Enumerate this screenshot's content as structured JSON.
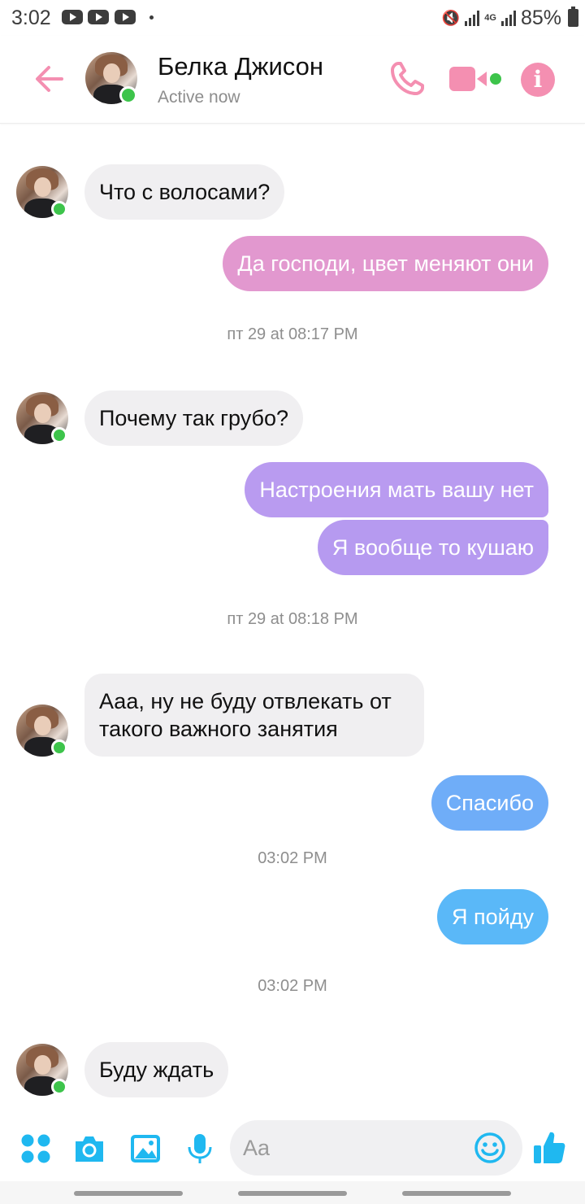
{
  "status_bar": {
    "time": "3:02",
    "network": "4G",
    "battery": "85%",
    "icons": [
      "youtube-icon",
      "youtube-icon",
      "youtube-icon",
      "mute-icon",
      "signal-icon",
      "battery-icon"
    ]
  },
  "header": {
    "name": "Белка Джисон",
    "status": "Active now",
    "icons": {
      "back": "back-arrow-icon",
      "call": "phone-icon",
      "video": "video-camera-icon",
      "info": "info-icon"
    },
    "info_glyph": "i",
    "accent_color": "#f48fb1",
    "online_color": "#3dc44b"
  },
  "conversation": {
    "incoming_1": "Что с волосами?",
    "outgoing_1": "Да господи, цвет меняют они",
    "timestamp_1": "пт 29 at 08:17 PM",
    "incoming_2": "Почему так грубо?",
    "outgoing_2": "Настроения мать вашу нет",
    "outgoing_3": "Я вообще то кушаю",
    "timestamp_2": "пт 29 at 08:18 PM",
    "incoming_3_line1": "Ааа, ну не буду отвлекать от",
    "incoming_3_line2": "такого важного занятия",
    "outgoing_4": "Спасибо",
    "timestamp_3": "03:02 PM",
    "outgoing_5": "Я пойду",
    "timestamp_4": "03:02 PM",
    "incoming_4": "Буду ждать",
    "bubble_colors": {
      "incoming": "#f0eff1",
      "outgoing_pink": "#e298cf",
      "outgoing_purple": "#b69af0",
      "outgoing_blue": "#6cb0f8"
    }
  },
  "composer": {
    "placeholder": "Aa",
    "icons": [
      "apps-icon",
      "camera-icon",
      "gallery-icon",
      "microphone-icon",
      "emoji-icon",
      "like-icon"
    ],
    "accent_color": "#1fb8f0"
  }
}
